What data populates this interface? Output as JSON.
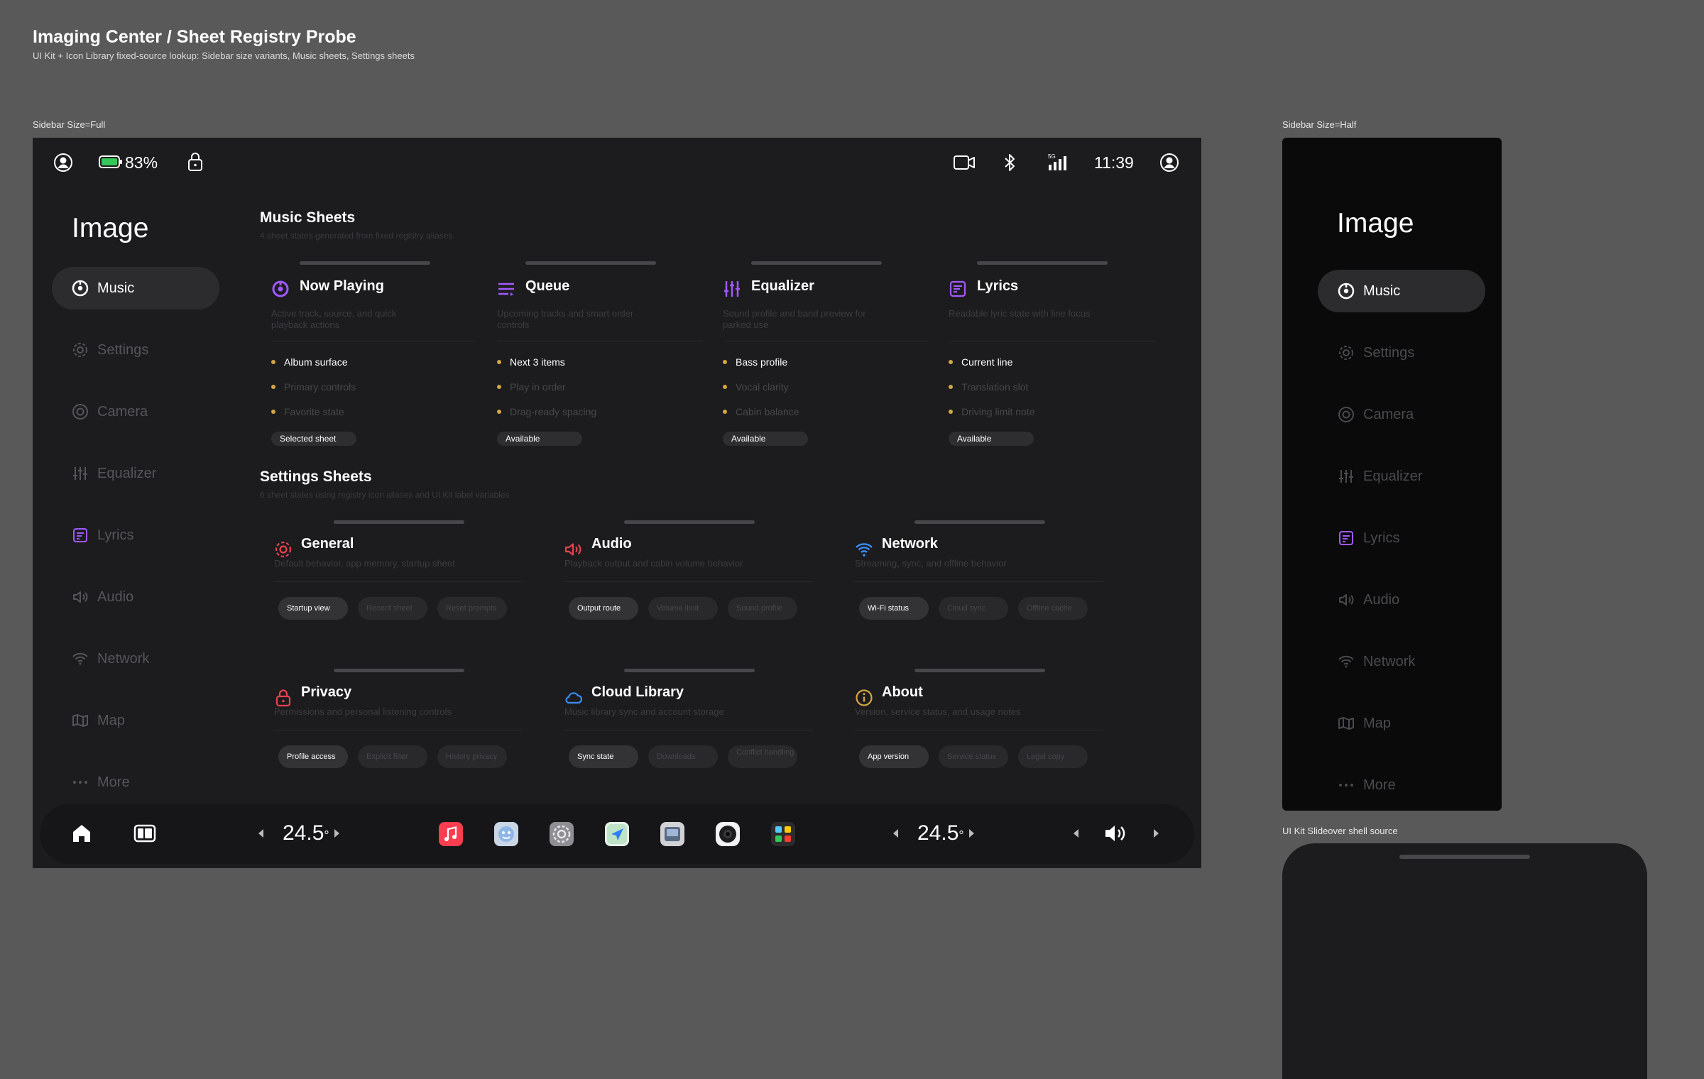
{
  "page": {
    "title": "Imaging Center / Sheet Registry Probe",
    "subtitle": "UI Kit + Icon Library fixed-source lookup: Sidebar size variants, Music sheets, Settings sheets"
  },
  "labels": {
    "full": "Sidebar Size=Full",
    "half": "Sidebar Size=Half",
    "slideover": "UI Kit Slideover shell source"
  },
  "status": {
    "battery": "83%",
    "time": "11:39",
    "signal": "5G"
  },
  "sidebar": {
    "title": "Image",
    "items": [
      {
        "label": "Music"
      },
      {
        "label": "Settings"
      },
      {
        "label": "Camera"
      },
      {
        "label": "Equalizer"
      },
      {
        "label": "Lyrics"
      },
      {
        "label": "Audio"
      },
      {
        "label": "Network"
      },
      {
        "label": "Map"
      },
      {
        "label": "More"
      }
    ]
  },
  "music": {
    "title": "Music Sheets",
    "subtitle": "4 sheet states generated from fixed registry aliases",
    "cards": [
      {
        "title": "Now Playing",
        "desc": "Active track, source, and quick playback actions",
        "bullets": [
          "Album surface",
          "Primary controls",
          "Favorite state"
        ],
        "badge": "Selected sheet"
      },
      {
        "title": "Queue",
        "desc": "Upcoming tracks and smart order controls",
        "bullets": [
          "Next 3 items",
          "Play in order",
          "Drag-ready spacing"
        ],
        "badge": "Available"
      },
      {
        "title": "Equalizer",
        "desc": "Sound profile and band preview for parked use",
        "bullets": [
          "Bass profile",
          "Vocal clarity",
          "Cabin balance"
        ],
        "badge": "Available"
      },
      {
        "title": "Lyrics",
        "desc": "Readable lyric state with line focus",
        "bullets": [
          "Current line",
          "Translation slot",
          "Driving limit note"
        ],
        "badge": "Available"
      }
    ]
  },
  "settings": {
    "title": "Settings Sheets",
    "subtitle": "6 sheet states using registry icon aliases and UI Kit label variables",
    "cards": [
      {
        "title": "General",
        "desc": "Default behavior, app memory, startup sheet",
        "pills": [
          "Startup view",
          "Recent sheet",
          "Reset prompts"
        ]
      },
      {
        "title": "Audio",
        "desc": "Playback output and cabin volume behavior",
        "pills": [
          "Output route",
          "Volume limit",
          "Sound profile"
        ]
      },
      {
        "title": "Network",
        "desc": "Streaming, sync, and offline behavior",
        "pills": [
          "Wi-Fi status",
          "Cloud sync",
          "Offline cache"
        ]
      },
      {
        "title": "Privacy",
        "desc": "Permissions and personal listening controls",
        "pills": [
          "Profile access",
          "Explicit filter",
          "History privacy"
        ]
      },
      {
        "title": "Cloud Library",
        "desc": "Music library sync and account storage",
        "pills": [
          "Sync state",
          "Downloads",
          "Conflict handling"
        ]
      },
      {
        "title": "About",
        "desc": "Version, service status, and usage notes",
        "pills": [
          "App version",
          "Service status",
          "Legal copy"
        ]
      }
    ]
  },
  "dock": {
    "temp_left": {
      "value": "24.5",
      "unit": "°"
    },
    "temp_right": {
      "value": "24.5",
      "unit": "°"
    },
    "apps": [
      "music-app-icon",
      "finder-app-icon",
      "settings-app-icon",
      "maps-app-icon",
      "preview-app-icon",
      "camera-app-icon",
      "widgets-app-icon"
    ]
  },
  "colors": {
    "background": "#595959",
    "panel": "#1c1c1e",
    "accent_purple": "#a259ff",
    "accent_red": "#e8414f",
    "accent_blue": "#3a8ef6",
    "accent_amber": "#d4a642",
    "battery_green": "#34c759"
  }
}
